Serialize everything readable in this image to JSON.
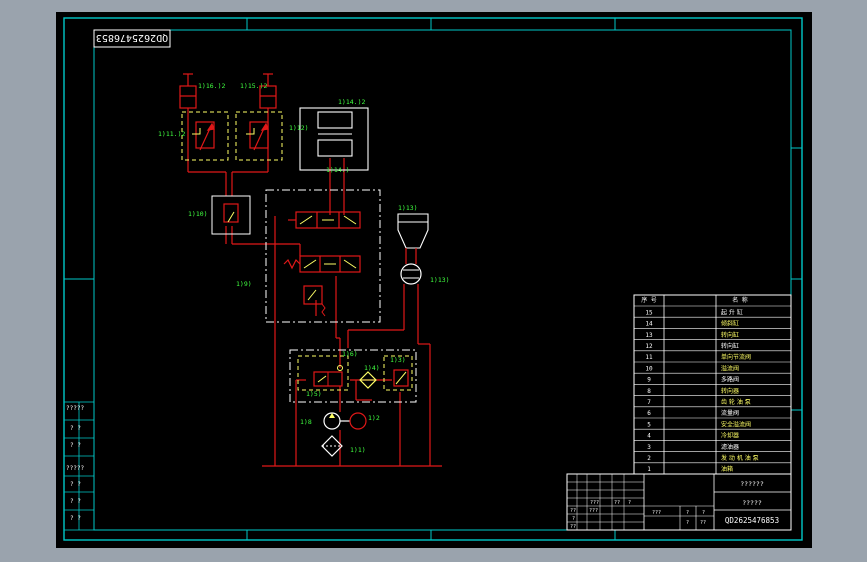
{
  "drawing": {
    "code_top_mirrored": "QD2625476853",
    "code_bottom": "QD2625476853",
    "colors": {
      "background": "#000000",
      "frame": "#00c8c8",
      "circuit": "#e01818",
      "component": "#ffffff",
      "dashed_box": "#ffff66",
      "label": "#40ff40",
      "viewport_bg": "#9aa3ad"
    }
  },
  "components": {
    "c16": "1)16.)2",
    "c15": "1)15.)2",
    "c11": "1)11.)2",
    "c14": "1)14.)2",
    "c12": "1)12)",
    "c14b": "1)14.)",
    "c10": "1)10)",
    "c9": "1)9)",
    "c13": "1)13)",
    "c13b": "1)13)",
    "c8": "1)8",
    "c2": "1)2",
    "c5": "1)5)",
    "c6": "1)6)",
    "c4": "1)4)",
    "c3": "1)3)",
    "c1": "1)1)"
  },
  "bom": {
    "col_no": "序 号",
    "col_name": "名 称",
    "rows": [
      {
        "no": "15",
        "name": "起 升 缸"
      },
      {
        "no": "14",
        "name": "倾斜缸"
      },
      {
        "no": "13",
        "name": "转向缸"
      },
      {
        "no": "12",
        "name": "转向缸"
      },
      {
        "no": "11",
        "name": "单向节流阀"
      },
      {
        "no": "10",
        "name": "溢流阀"
      },
      {
        "no": "9",
        "name": "多路阀"
      },
      {
        "no": "8",
        "name": "转向器"
      },
      {
        "no": "7",
        "name": "齿 轮 油 泵"
      },
      {
        "no": "6",
        "name": "流量阀"
      },
      {
        "no": "5",
        "name": "安全溢流阀"
      },
      {
        "no": "4",
        "name": "冷却器"
      },
      {
        "no": "3",
        "name": "滤油器"
      },
      {
        "no": "2",
        "name": "发 动 机 油 泵"
      },
      {
        "no": "1",
        "name": "油箱"
      }
    ]
  },
  "title_block": {
    "title_1": "??????",
    "title_2": "?????",
    "drawing_no": "QD2625476853",
    "small_1": "???",
    "small_2": "???",
    "small_3": "?",
    "small_4": "?",
    "small_5": "?",
    "small_6": "??",
    "small_7": "??",
    "small_8": "?",
    "small_9": "??",
    "small_10": "??",
    "small_11": "?",
    "small_12": "???"
  },
  "left_strip": {
    "s1": "?????",
    "s2": "? ?",
    "s3": "? ?",
    "s4": "?????",
    "s5": "? ?",
    "s6": "? ?",
    "s7": "? ?"
  }
}
